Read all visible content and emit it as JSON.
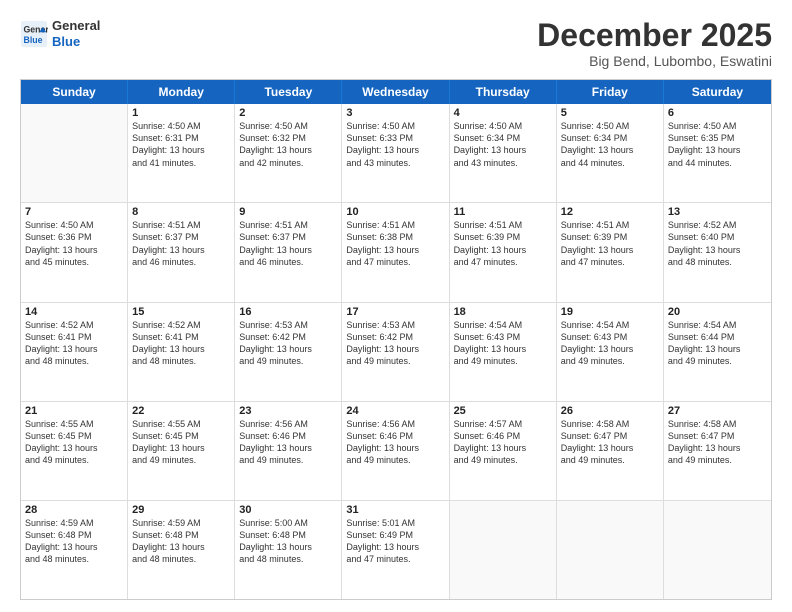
{
  "header": {
    "logo_line1": "General",
    "logo_line2": "Blue",
    "month": "December 2025",
    "location": "Big Bend, Lubombo, Eswatini"
  },
  "weekdays": [
    "Sunday",
    "Monday",
    "Tuesday",
    "Wednesday",
    "Thursday",
    "Friday",
    "Saturday"
  ],
  "rows": [
    [
      {
        "day": "",
        "lines": []
      },
      {
        "day": "1",
        "lines": [
          "Sunrise: 4:50 AM",
          "Sunset: 6:31 PM",
          "Daylight: 13 hours",
          "and 41 minutes."
        ]
      },
      {
        "day": "2",
        "lines": [
          "Sunrise: 4:50 AM",
          "Sunset: 6:32 PM",
          "Daylight: 13 hours",
          "and 42 minutes."
        ]
      },
      {
        "day": "3",
        "lines": [
          "Sunrise: 4:50 AM",
          "Sunset: 6:33 PM",
          "Daylight: 13 hours",
          "and 43 minutes."
        ]
      },
      {
        "day": "4",
        "lines": [
          "Sunrise: 4:50 AM",
          "Sunset: 6:34 PM",
          "Daylight: 13 hours",
          "and 43 minutes."
        ]
      },
      {
        "day": "5",
        "lines": [
          "Sunrise: 4:50 AM",
          "Sunset: 6:34 PM",
          "Daylight: 13 hours",
          "and 44 minutes."
        ]
      },
      {
        "day": "6",
        "lines": [
          "Sunrise: 4:50 AM",
          "Sunset: 6:35 PM",
          "Daylight: 13 hours",
          "and 44 minutes."
        ]
      }
    ],
    [
      {
        "day": "7",
        "lines": [
          "Sunrise: 4:50 AM",
          "Sunset: 6:36 PM",
          "Daylight: 13 hours",
          "and 45 minutes."
        ]
      },
      {
        "day": "8",
        "lines": [
          "Sunrise: 4:51 AM",
          "Sunset: 6:37 PM",
          "Daylight: 13 hours",
          "and 46 minutes."
        ]
      },
      {
        "day": "9",
        "lines": [
          "Sunrise: 4:51 AM",
          "Sunset: 6:37 PM",
          "Daylight: 13 hours",
          "and 46 minutes."
        ]
      },
      {
        "day": "10",
        "lines": [
          "Sunrise: 4:51 AM",
          "Sunset: 6:38 PM",
          "Daylight: 13 hours",
          "and 47 minutes."
        ]
      },
      {
        "day": "11",
        "lines": [
          "Sunrise: 4:51 AM",
          "Sunset: 6:39 PM",
          "Daylight: 13 hours",
          "and 47 minutes."
        ]
      },
      {
        "day": "12",
        "lines": [
          "Sunrise: 4:51 AM",
          "Sunset: 6:39 PM",
          "Daylight: 13 hours",
          "and 47 minutes."
        ]
      },
      {
        "day": "13",
        "lines": [
          "Sunrise: 4:52 AM",
          "Sunset: 6:40 PM",
          "Daylight: 13 hours",
          "and 48 minutes."
        ]
      }
    ],
    [
      {
        "day": "14",
        "lines": [
          "Sunrise: 4:52 AM",
          "Sunset: 6:41 PM",
          "Daylight: 13 hours",
          "and 48 minutes."
        ]
      },
      {
        "day": "15",
        "lines": [
          "Sunrise: 4:52 AM",
          "Sunset: 6:41 PM",
          "Daylight: 13 hours",
          "and 48 minutes."
        ]
      },
      {
        "day": "16",
        "lines": [
          "Sunrise: 4:53 AM",
          "Sunset: 6:42 PM",
          "Daylight: 13 hours",
          "and 49 minutes."
        ]
      },
      {
        "day": "17",
        "lines": [
          "Sunrise: 4:53 AM",
          "Sunset: 6:42 PM",
          "Daylight: 13 hours",
          "and 49 minutes."
        ]
      },
      {
        "day": "18",
        "lines": [
          "Sunrise: 4:54 AM",
          "Sunset: 6:43 PM",
          "Daylight: 13 hours",
          "and 49 minutes."
        ]
      },
      {
        "day": "19",
        "lines": [
          "Sunrise: 4:54 AM",
          "Sunset: 6:43 PM",
          "Daylight: 13 hours",
          "and 49 minutes."
        ]
      },
      {
        "day": "20",
        "lines": [
          "Sunrise: 4:54 AM",
          "Sunset: 6:44 PM",
          "Daylight: 13 hours",
          "and 49 minutes."
        ]
      }
    ],
    [
      {
        "day": "21",
        "lines": [
          "Sunrise: 4:55 AM",
          "Sunset: 6:45 PM",
          "Daylight: 13 hours",
          "and 49 minutes."
        ]
      },
      {
        "day": "22",
        "lines": [
          "Sunrise: 4:55 AM",
          "Sunset: 6:45 PM",
          "Daylight: 13 hours",
          "and 49 minutes."
        ]
      },
      {
        "day": "23",
        "lines": [
          "Sunrise: 4:56 AM",
          "Sunset: 6:46 PM",
          "Daylight: 13 hours",
          "and 49 minutes."
        ]
      },
      {
        "day": "24",
        "lines": [
          "Sunrise: 4:56 AM",
          "Sunset: 6:46 PM",
          "Daylight: 13 hours",
          "and 49 minutes."
        ]
      },
      {
        "day": "25",
        "lines": [
          "Sunrise: 4:57 AM",
          "Sunset: 6:46 PM",
          "Daylight: 13 hours",
          "and 49 minutes."
        ]
      },
      {
        "day": "26",
        "lines": [
          "Sunrise: 4:58 AM",
          "Sunset: 6:47 PM",
          "Daylight: 13 hours",
          "and 49 minutes."
        ]
      },
      {
        "day": "27",
        "lines": [
          "Sunrise: 4:58 AM",
          "Sunset: 6:47 PM",
          "Daylight: 13 hours",
          "and 49 minutes."
        ]
      }
    ],
    [
      {
        "day": "28",
        "lines": [
          "Sunrise: 4:59 AM",
          "Sunset: 6:48 PM",
          "Daylight: 13 hours",
          "and 48 minutes."
        ]
      },
      {
        "day": "29",
        "lines": [
          "Sunrise: 4:59 AM",
          "Sunset: 6:48 PM",
          "Daylight: 13 hours",
          "and 48 minutes."
        ]
      },
      {
        "day": "30",
        "lines": [
          "Sunrise: 5:00 AM",
          "Sunset: 6:48 PM",
          "Daylight: 13 hours",
          "and 48 minutes."
        ]
      },
      {
        "day": "31",
        "lines": [
          "Sunrise: 5:01 AM",
          "Sunset: 6:49 PM",
          "Daylight: 13 hours",
          "and 47 minutes."
        ]
      },
      {
        "day": "",
        "lines": []
      },
      {
        "day": "",
        "lines": []
      },
      {
        "day": "",
        "lines": []
      }
    ]
  ]
}
